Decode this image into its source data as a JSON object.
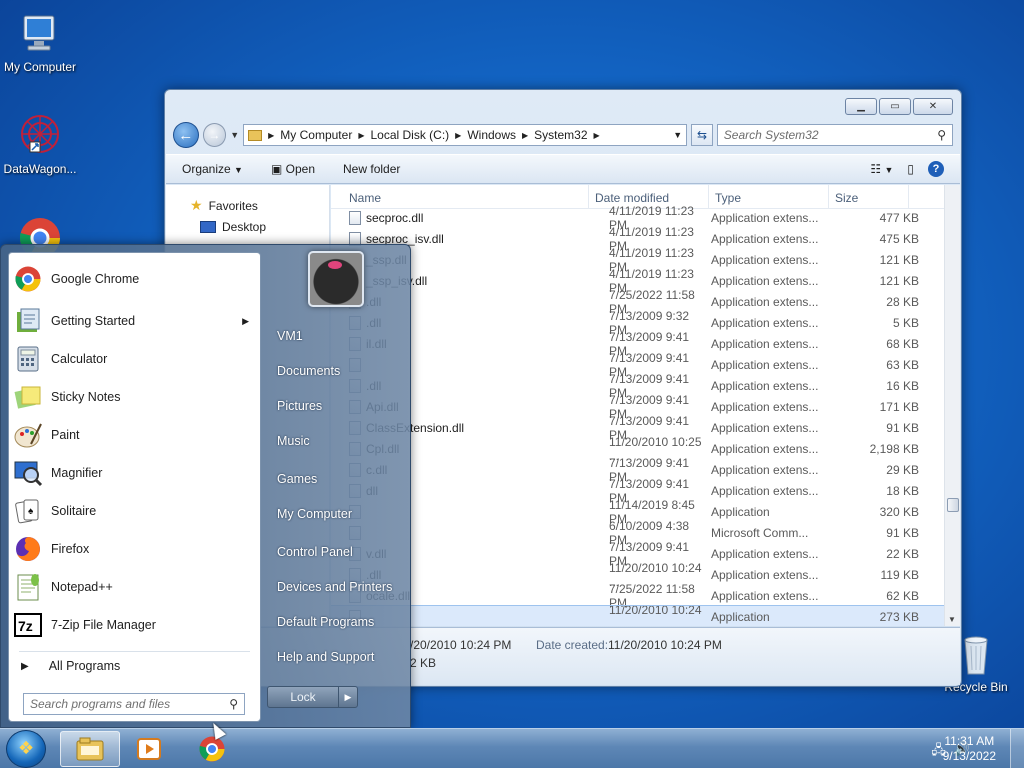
{
  "desktop": {
    "icons": [
      {
        "label": "My Computer"
      },
      {
        "label": "DataWagon..."
      },
      {
        "label": "Recycle Bin"
      }
    ]
  },
  "explorer": {
    "breadcrumb": [
      "My Computer",
      "Local Disk (C:)",
      "Windows",
      "System32"
    ],
    "search_placeholder": "Search System32",
    "toolbar": {
      "organize": "Organize",
      "open": "Open",
      "new_folder": "New folder"
    },
    "nav": {
      "favorites": "Favorites",
      "desktop": "Desktop"
    },
    "columns": {
      "name": "Name",
      "date": "Date modified",
      "type": "Type",
      "size": "Size"
    },
    "files": [
      {
        "name": "secproc.dll",
        "date": "4/11/2019 11:23 PM",
        "type": "Application extens...",
        "size": "477 KB"
      },
      {
        "name": "secproc_isv.dll",
        "date": "4/11/2019 11:23 PM",
        "type": "Application extens...",
        "size": "475 KB"
      },
      {
        "name": "_ssp.dll",
        "date": "4/11/2019 11:23 PM",
        "type": "Application extens...",
        "size": "121 KB"
      },
      {
        "name": "_ssp_isv.dll",
        "date": "4/11/2019 11:23 PM",
        "type": "Application extens...",
        "size": "121 KB"
      },
      {
        "name": ".dll",
        "date": "7/25/2022 11:58 PM",
        "type": "Application extens...",
        "size": "28 KB"
      },
      {
        "name": ".dll",
        "date": "7/13/2009 9:32 PM",
        "type": "Application extens...",
        "size": "5 KB"
      },
      {
        "name": "il.dll",
        "date": "7/13/2009 9:41 PM",
        "type": "Application extens...",
        "size": "68 KB"
      },
      {
        "name": "",
        "date": "7/13/2009 9:41 PM",
        "type": "Application extens...",
        "size": "63 KB"
      },
      {
        "name": ".dll",
        "date": "7/13/2009 9:41 PM",
        "type": "Application extens...",
        "size": "16 KB"
      },
      {
        "name": "Api.dll",
        "date": "7/13/2009 9:41 PM",
        "type": "Application extens...",
        "size": "171 KB"
      },
      {
        "name": "ClassExtension.dll",
        "date": "7/13/2009 9:41 PM",
        "type": "Application extens...",
        "size": "91 KB"
      },
      {
        "name": "Cpl.dll",
        "date": "11/20/2010 10:25 ...",
        "type": "Application extens...",
        "size": "2,198 KB"
      },
      {
        "name": "c.dll",
        "date": "7/13/2009 9:41 PM",
        "type": "Application extens...",
        "size": "29 KB"
      },
      {
        "name": "dll",
        "date": "7/13/2009 9:41 PM",
        "type": "Application extens...",
        "size": "18 KB"
      },
      {
        "name": "",
        "date": "11/14/2019 8:45 PM",
        "type": "Application",
        "size": "320 KB"
      },
      {
        "name": "",
        "date": "6/10/2009 4:38 PM",
        "type": "Microsoft Comm...",
        "size": "91 KB"
      },
      {
        "name": "v.dll",
        "date": "7/13/2009 9:41 PM",
        "type": "Application extens...",
        "size": "22 KB"
      },
      {
        "name": ".dll",
        "date": "11/20/2010 10:24 ...",
        "type": "Application extens...",
        "size": "119 KB"
      },
      {
        "name": "ocale.dll",
        "date": "7/25/2022 11:58 PM",
        "type": "Application extens...",
        "size": "62 KB"
      },
      {
        "name": "",
        "date": "11/20/2010 10:24 ...",
        "type": "Application",
        "size": "273 KB"
      }
    ],
    "details": {
      "modified": "/20/2010 10:24 PM",
      "created_label": "Date created:",
      "created": "11/20/2010 10:24 PM",
      "size": "2 KB"
    }
  },
  "start_menu": {
    "programs": [
      {
        "label": "Google Chrome",
        "icon": "chrome-icon",
        "submenu": false
      },
      {
        "label": "Getting Started",
        "icon": "getting-started-icon",
        "submenu": true
      },
      {
        "label": "Calculator",
        "icon": "calculator-icon",
        "submenu": false
      },
      {
        "label": "Sticky Notes",
        "icon": "sticky-notes-icon",
        "submenu": false
      },
      {
        "label": "Paint",
        "icon": "paint-icon",
        "submenu": false
      },
      {
        "label": "Magnifier",
        "icon": "magnifier-icon",
        "submenu": false
      },
      {
        "label": "Solitaire",
        "icon": "solitaire-icon",
        "submenu": false
      },
      {
        "label": "Firefox",
        "icon": "firefox-icon",
        "submenu": false
      },
      {
        "label": "Notepad++",
        "icon": "notepadpp-icon",
        "submenu": false
      },
      {
        "label": "7-Zip File Manager",
        "icon": "7zip-icon",
        "submenu": false
      }
    ],
    "all_programs": "All Programs",
    "search_placeholder": "Search programs and files",
    "right": [
      "VM1",
      "Documents",
      "Pictures",
      "Music",
      "Games",
      "My Computer",
      "Control Panel",
      "Devices and Printers",
      "Default Programs",
      "Help and Support"
    ],
    "lock": "Lock"
  },
  "taskbar": {
    "time": "11:31 AM",
    "date": "9/13/2022"
  }
}
